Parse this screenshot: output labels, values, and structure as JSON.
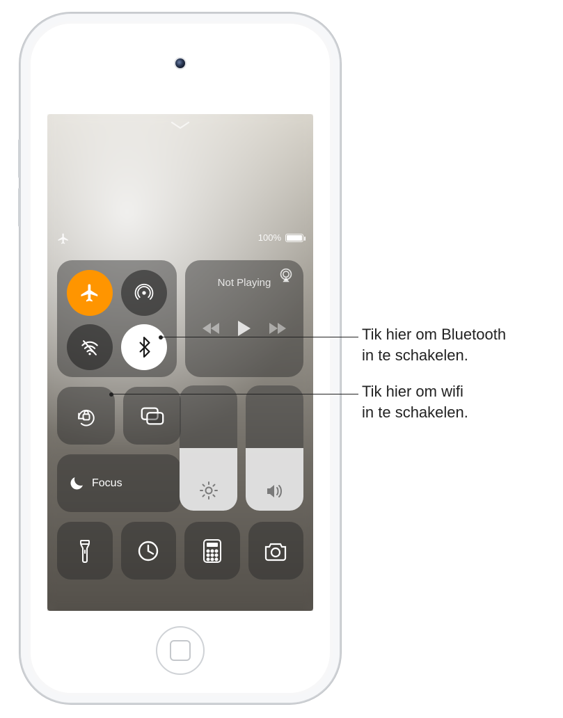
{
  "status": {
    "battery_text": "100%"
  },
  "connectivity": {
    "airplane": {
      "label": "Airplane Mode",
      "on": true
    },
    "airdrop": {
      "label": "AirDrop"
    },
    "wifi": {
      "label": "Wi-Fi",
      "off": true
    },
    "bluetooth": {
      "label": "Bluetooth"
    }
  },
  "media": {
    "title": "Not Playing"
  },
  "focus": {
    "label": "Focus"
  },
  "callouts": {
    "bluetooth": "Tik hier om Bluetooth in te schakelen.",
    "wifi": "Tik hier om wifi in te schakelen."
  }
}
